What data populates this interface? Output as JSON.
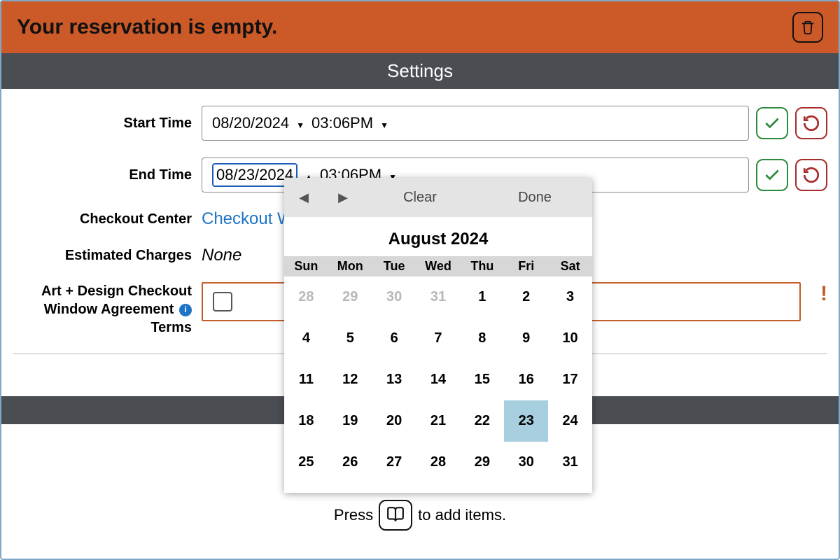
{
  "banner": {
    "title": "Your reservation is empty."
  },
  "settings_header": "Settings",
  "form": {
    "start_label": "Start Time",
    "start_date": "08/20/2024",
    "start_time": "03:06PM",
    "end_label": "End Time",
    "end_date": "08/23/2024",
    "end_time": "03:06PM",
    "checkout_center_label": "Checkout Center",
    "checkout_center_value": "Checkout W",
    "est_charges_label": "Estimated Charges",
    "est_charges_value": "None",
    "agreement_label_1": "Art + Design Checkout",
    "agreement_label_2": "Window Agreement",
    "agreement_label_3": "Terms"
  },
  "calendar": {
    "clear": "Clear",
    "done": "Done",
    "title": "August 2024",
    "dow": [
      "Sun",
      "Mon",
      "Tue",
      "Wed",
      "Thu",
      "Fri",
      "Sat"
    ],
    "days": [
      {
        "n": "28",
        "other": true
      },
      {
        "n": "29",
        "other": true
      },
      {
        "n": "30",
        "other": true
      },
      {
        "n": "31",
        "other": true
      },
      {
        "n": "1"
      },
      {
        "n": "2"
      },
      {
        "n": "3"
      },
      {
        "n": "4"
      },
      {
        "n": "5"
      },
      {
        "n": "6"
      },
      {
        "n": "7"
      },
      {
        "n": "8"
      },
      {
        "n": "9"
      },
      {
        "n": "10"
      },
      {
        "n": "11"
      },
      {
        "n": "12"
      },
      {
        "n": "13"
      },
      {
        "n": "14"
      },
      {
        "n": "15"
      },
      {
        "n": "16"
      },
      {
        "n": "17"
      },
      {
        "n": "18"
      },
      {
        "n": "19"
      },
      {
        "n": "20"
      },
      {
        "n": "21"
      },
      {
        "n": "22"
      },
      {
        "n": "23",
        "selected": true
      },
      {
        "n": "24"
      },
      {
        "n": "25"
      },
      {
        "n": "26"
      },
      {
        "n": "27"
      },
      {
        "n": "28"
      },
      {
        "n": "29"
      },
      {
        "n": "30"
      },
      {
        "n": "31"
      }
    ]
  },
  "add_items": {
    "prefix": "Press",
    "suffix": "to add items."
  }
}
